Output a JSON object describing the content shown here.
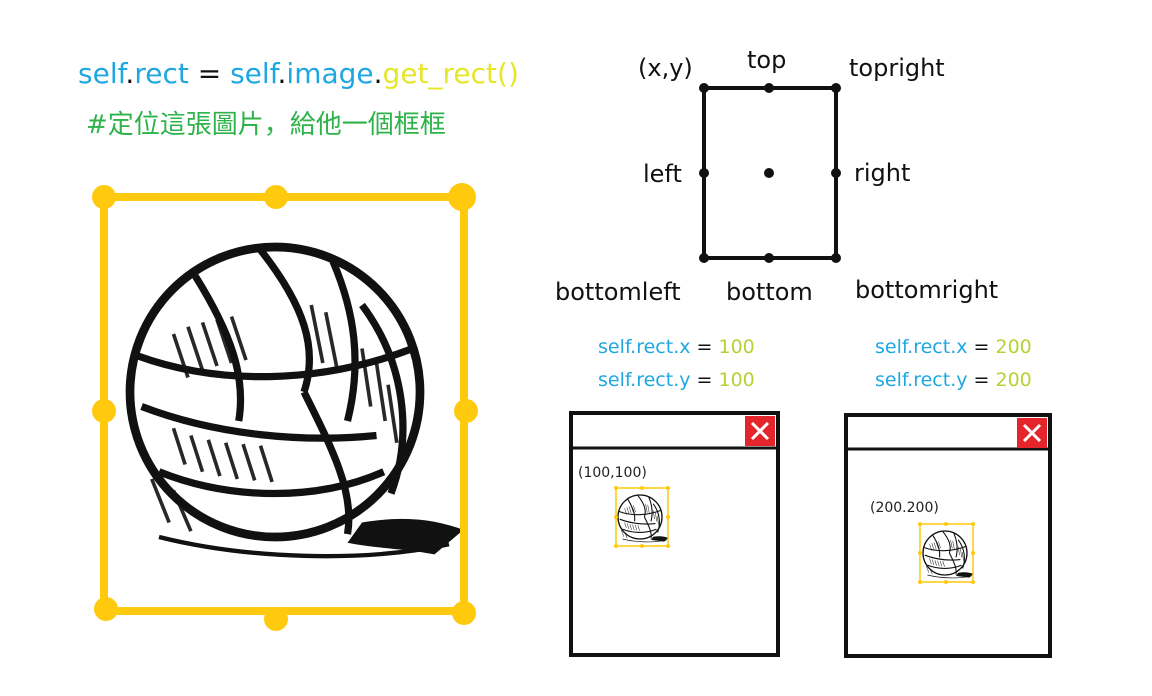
{
  "colors": {
    "blue": "#1ea7e1",
    "green": "#2db34a",
    "yellow": "#e6e62a",
    "rect_yellow": "#ffc90e",
    "close_red": "#e4262c"
  },
  "code": {
    "tokens": [
      {
        "text": "self",
        "color": "blue"
      },
      {
        "text": ".",
        "color": "black"
      },
      {
        "text": "rect",
        "color": "blue"
      },
      {
        "text": " = ",
        "color": "black"
      },
      {
        "text": "self",
        "color": "blue"
      },
      {
        "text": ".",
        "color": "black"
      },
      {
        "text": "image",
        "color": "blue"
      },
      {
        "text": ".",
        "color": "black"
      },
      {
        "text": "get_rect()",
        "color": "yellow"
      }
    ],
    "comment": "#定位這張圖片，給他一個框框"
  },
  "rect_labels": {
    "xy": "(x,y)",
    "top": "top",
    "topright": "topright",
    "left": "left",
    "right": "right",
    "bottomleft": "bottomleft",
    "bottom": "bottom",
    "bottomright": "bottomright"
  },
  "examples": [
    {
      "x_label": "self.rect.x",
      "x_value": "100",
      "y_label": "self.rect.y",
      "y_value": "100",
      "window_coord": "(100,100)",
      "close_icon": "close-x-icon"
    },
    {
      "x_label": "self.rect.x",
      "x_value": "200",
      "y_label": "self.rect.y",
      "y_value": "200",
      "window_coord": "(200.200)",
      "close_icon": "close-x-icon"
    }
  ]
}
